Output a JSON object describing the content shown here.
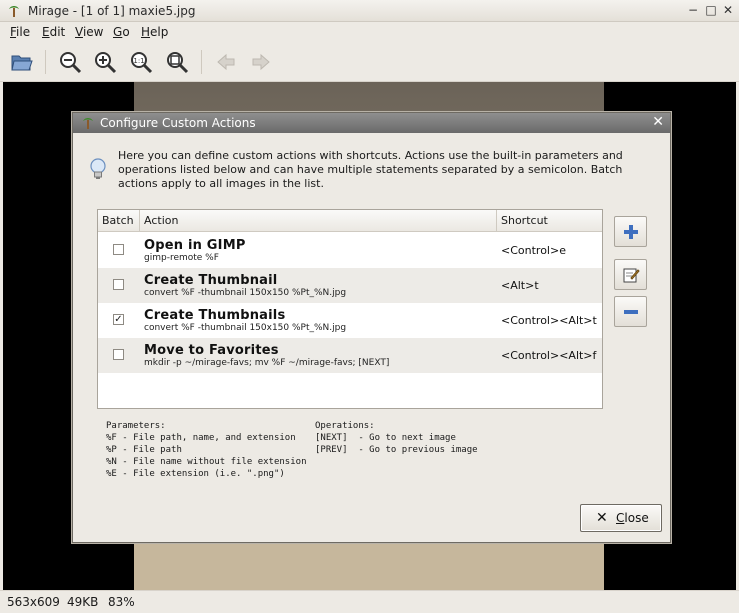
{
  "window": {
    "title": "Mirage - [1 of 1] maxie5.jpg",
    "controls": {
      "minimize": "−",
      "maximize": "□",
      "close": "✕"
    }
  },
  "menu": {
    "items": [
      {
        "label": "File"
      },
      {
        "label": "Edit"
      },
      {
        "label": "View"
      },
      {
        "label": "Go"
      },
      {
        "label": "Help"
      }
    ]
  },
  "toolbar": {
    "buttons": [
      {
        "icon": "open-folder-icon"
      },
      {
        "icon": "zoom-out-icon"
      },
      {
        "icon": "zoom-in-icon"
      },
      {
        "icon": "zoom-1-1-icon"
      },
      {
        "icon": "zoom-fit-icon"
      },
      {
        "icon": "previous-image-icon"
      },
      {
        "icon": "next-image-icon"
      }
    ]
  },
  "statusbar": {
    "dimensions": "563x609",
    "size": "49KB",
    "zoom": "83%"
  },
  "dialog": {
    "title": "Configure Custom Actions",
    "description": "Here you can define custom actions with shortcuts. Actions use the built-in parameters and operations listed below and can have multiple statements separated by a semicolon. Batch actions apply to all images in the list.",
    "columns": {
      "batch": "Batch",
      "action": "Action",
      "shortcut": "Shortcut"
    },
    "actions": [
      {
        "name": "Open in GIMP",
        "command": "gimp-remote %F",
        "shortcut": "<Control>e",
        "batch": false
      },
      {
        "name": "Create Thumbnail",
        "command": "convert %F -thumbnail 150x150 %Pt_%N.jpg",
        "shortcut": "<Alt>t",
        "batch": false
      },
      {
        "name": "Create Thumbnails",
        "command": "convert %F -thumbnail 150x150 %Pt_%N.jpg",
        "shortcut": "<Control><Alt>t",
        "batch": true
      },
      {
        "name": "Move to Favorites",
        "command": "mkdir -p ~/mirage-favs; mv %F ~/mirage-favs; [NEXT]",
        "shortcut": "<Control><Alt>f",
        "batch": false
      }
    ],
    "parameters": {
      "heading": "Parameters:",
      "items": [
        "%F - File path, name, and extension",
        "%P - File path",
        "%N - File name without file extension",
        "%E - File extension (i.e. \".png\")"
      ]
    },
    "operations": {
      "heading": "Operations:",
      "items": [
        "[NEXT]  - Go to next image",
        "[PREV]  - Go to previous image"
      ]
    },
    "side_buttons": [
      {
        "icon": "add-icon"
      },
      {
        "icon": "edit-icon"
      },
      {
        "icon": "remove-icon"
      }
    ],
    "close_label": "Close",
    "title_close": "✕"
  },
  "colors": {
    "checkmark": "✓"
  }
}
